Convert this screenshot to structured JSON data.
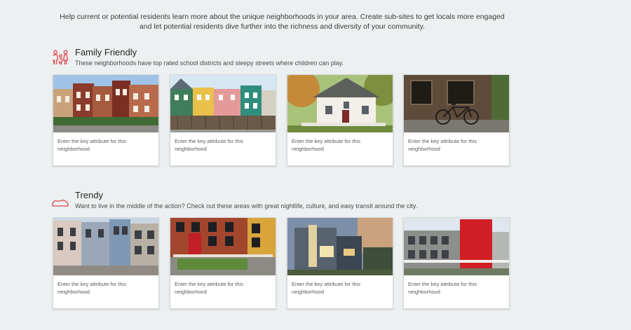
{
  "intro": {
    "line1": "Help current or potential residents learn more about the unique neighborhoods in your area. Create sub-sites to get locals more engaged",
    "line2": "and let potential residents dive further into the richness and diversity of your community."
  },
  "sections": [
    {
      "icon": "family-icon",
      "title": "Family Friendly",
      "subtitle": "These neighborhoods have top rated school districts and sleepy streets where children can play.",
      "cards": [
        {
          "attribute": "Enter the key attribute for this neighborhood",
          "photo": "brownstone-row-houses"
        },
        {
          "attribute": "Enter the key attribute for this neighborhood",
          "photo": "colorful-row-houses"
        },
        {
          "attribute": "Enter the key attribute for this neighborhood",
          "photo": "white-cottage"
        },
        {
          "attribute": "Enter the key attribute for this neighborhood",
          "photo": "bicycle-window"
        }
      ]
    },
    {
      "icon": "shoe-icon",
      "title": "Trendy",
      "subtitle": "Want to live in the middle of the action? Check out these areas with great nightlife, culture, and easy transit around the city.",
      "cards": [
        {
          "attribute": "Enter the key attribute for this neighborhood",
          "photo": "pastel-townhouses"
        },
        {
          "attribute": "Enter the key attribute for this neighborhood",
          "photo": "brick-red-door"
        },
        {
          "attribute": "Enter the key attribute for this neighborhood",
          "photo": "modern-house-dusk"
        },
        {
          "attribute": "Enter the key attribute for this neighborhood",
          "photo": "red-modern-building"
        }
      ]
    }
  ],
  "colors": {
    "background": "#edf0f1",
    "accent": "#e0474c",
    "card": "#ffffff"
  }
}
